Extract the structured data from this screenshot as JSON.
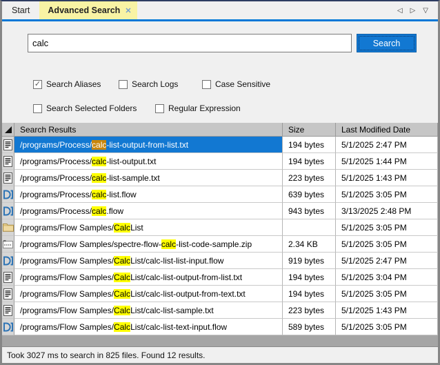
{
  "window": {
    "tabs": [
      {
        "label": "Start",
        "active": false
      },
      {
        "label": "Advanced Search",
        "active": true,
        "close_glyph": "✕"
      }
    ],
    "nav": {
      "prev_glyph": "◁",
      "next_glyph": "▷",
      "menu_glyph": "▽"
    }
  },
  "search": {
    "query": "calc",
    "button_label": "Search",
    "check_glyph": "✓",
    "options_row1": [
      {
        "label": "Search Aliases",
        "checked": true
      },
      {
        "label": "Search Logs",
        "checked": false
      },
      {
        "label": "Case Sensitive",
        "checked": false
      }
    ],
    "options_row2": [
      {
        "label": "Search Selected Folders",
        "checked": false
      },
      {
        "label": "Regular Expression",
        "checked": false
      }
    ]
  },
  "table": {
    "columns": [
      "Search Results",
      "Size",
      "Last Modified Date"
    ],
    "rows": [
      {
        "icon": "text-file",
        "prefix": "/programs/Process/",
        "match": "calc",
        "suffix": "-list-output-from-list.txt",
        "size": "194 bytes",
        "date": "5/1/2025 2:47 PM",
        "selected": true
      },
      {
        "icon": "text-file",
        "prefix": "/programs/Process/",
        "match": "calc",
        "suffix": "-list-output.txt",
        "size": "194 bytes",
        "date": "5/1/2025 1:44 PM",
        "selected": false
      },
      {
        "icon": "text-file",
        "prefix": "/programs/Process/",
        "match": "calc",
        "suffix": "-list-sample.txt",
        "size": "223 bytes",
        "date": "5/1/2025 1:43 PM",
        "selected": false
      },
      {
        "icon": "flow",
        "prefix": "/programs/Process/",
        "match": "calc",
        "suffix": "-list.flow",
        "size": "639 bytes",
        "date": "5/1/2025 3:05 PM",
        "selected": false
      },
      {
        "icon": "flow",
        "prefix": "/programs/Process/",
        "match": "calc",
        "suffix": ".flow",
        "size": "943 bytes",
        "date": "3/13/2025 2:48 PM",
        "selected": false
      },
      {
        "icon": "folder",
        "prefix": "/programs/Flow Samples/",
        "match": "Calc",
        "suffix": " List",
        "size": "",
        "date": "5/1/2025 3:05 PM",
        "selected": false
      },
      {
        "icon": "zip",
        "prefix": "/programs/Flow Samples/spectre-flow-",
        "match": "calc",
        "suffix": "-list-code-sample.zip",
        "size": "2.34 KB",
        "date": "5/1/2025 3:05 PM",
        "selected": false
      },
      {
        "icon": "flow",
        "prefix": "/programs/Flow Samples/",
        "match": "Calc",
        "suffix": " List/calc-list-list-input.flow",
        "size": "919 bytes",
        "date": "5/1/2025 2:47 PM",
        "selected": false
      },
      {
        "icon": "text-file",
        "prefix": "/programs/Flow Samples/",
        "match": "Calc",
        "suffix": " List/calc-list-output-from-list.txt",
        "size": "194 bytes",
        "date": "5/1/2025 3:04 PM",
        "selected": false
      },
      {
        "icon": "text-file",
        "prefix": "/programs/Flow Samples/",
        "match": "Calc",
        "suffix": " List/calc-list-output-from-text.txt",
        "size": "194 bytes",
        "date": "5/1/2025 3:05 PM",
        "selected": false
      },
      {
        "icon": "text-file",
        "prefix": "/programs/Flow Samples/",
        "match": "Calc",
        "suffix": " List/calc-list-sample.txt",
        "size": "223 bytes",
        "date": "5/1/2025 1:43 PM",
        "selected": false
      },
      {
        "icon": "flow",
        "prefix": "/programs/Flow Samples/",
        "match": "Calc",
        "suffix": " List/calc-list-text-input.flow",
        "size": "589 bytes",
        "date": "5/1/2025 3:05 PM",
        "selected": false
      }
    ]
  },
  "status_bar": {
    "text": "Took 3027 ms to search in 825 files. Found 12 results."
  },
  "colors": {
    "accent_line": "#0078d7",
    "active_tab_bg": "#f8f3a4",
    "button_bg": "#1278d2",
    "selection_bg": "#1278d2",
    "match_highlight": "#ffff00",
    "match_highlight_selected": "#c8860b",
    "header_bg": "#c6c6c6"
  }
}
